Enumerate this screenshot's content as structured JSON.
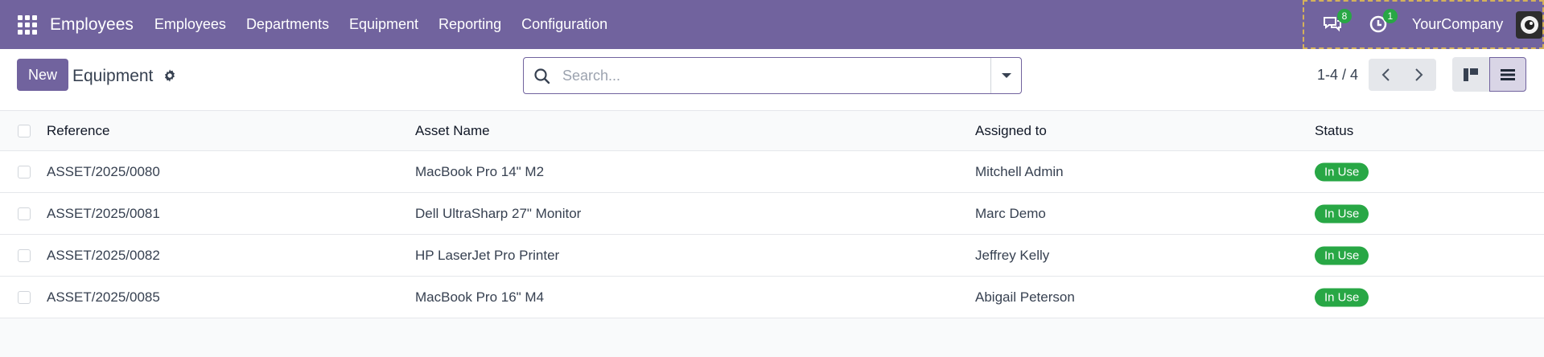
{
  "navbar": {
    "brand": "Employees",
    "menu": [
      "Employees",
      "Departments",
      "Equipment",
      "Reporting",
      "Configuration"
    ],
    "messages_count": "8",
    "activities_count": "1",
    "company": "YourCompany"
  },
  "control": {
    "new_label": "New",
    "title": "Equipment",
    "search_placeholder": "Search...",
    "pager": "1-4 / 4"
  },
  "table": {
    "headers": {
      "reference": "Reference",
      "asset_name": "Asset Name",
      "assigned_to": "Assigned to",
      "status": "Status"
    },
    "rows": [
      {
        "reference": "ASSET/2025/0080",
        "asset_name": "MacBook Pro 14\" M2",
        "assigned_to": "Mitchell Admin",
        "status": "In Use"
      },
      {
        "reference": "ASSET/2025/0081",
        "asset_name": "Dell UltraSharp 27\" Monitor",
        "assigned_to": "Marc Demo",
        "status": "In Use"
      },
      {
        "reference": "ASSET/2025/0082",
        "asset_name": "HP LaserJet Pro Printer",
        "assigned_to": "Jeffrey Kelly",
        "status": "In Use"
      },
      {
        "reference": "ASSET/2025/0085",
        "asset_name": "MacBook Pro 16\" M4",
        "assigned_to": "Abigail Peterson",
        "status": "In Use"
      }
    ]
  },
  "colors": {
    "brand": "#71639e",
    "status_in_use": "#28a745"
  }
}
